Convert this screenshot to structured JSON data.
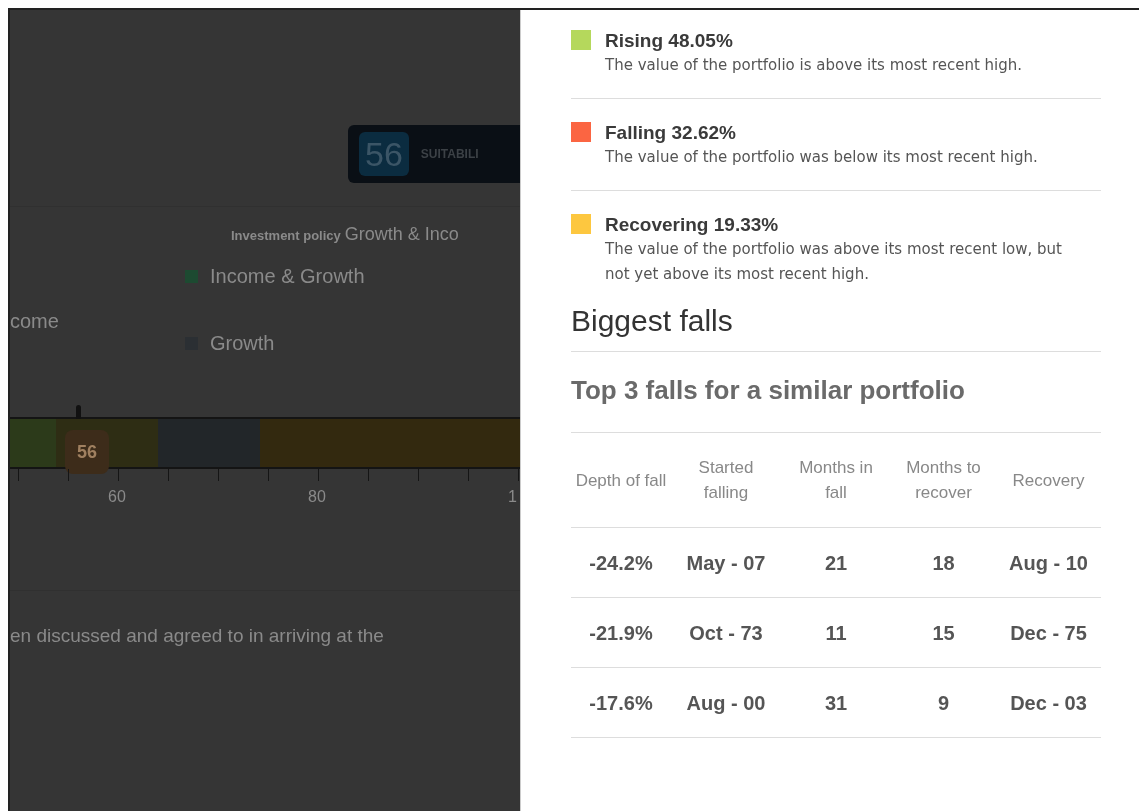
{
  "background_page": {
    "suitability_badge": {
      "score": "56",
      "label": "SUITABILI"
    },
    "investment_policy": {
      "label": "Investment policy",
      "value": "Growth & Inco"
    },
    "legend": [
      {
        "label": "Income & Growth",
        "color": "#1d4a31"
      },
      {
        "label": "come"
      },
      {
        "label": "Growth",
        "color": "#2b2f33"
      }
    ],
    "scale": {
      "segments": [
        {
          "color": "#2c3a1a"
        },
        {
          "color": "#2e2d14"
        },
        {
          "color": "#222629"
        },
        {
          "color": "#33290f"
        }
      ],
      "marker": "56",
      "tick_labels": [
        "60",
        "80",
        "1"
      ]
    },
    "note": "en discussed and agreed to in arriving at the"
  },
  "panel": {
    "states": [
      {
        "title": "Rising 48.05%",
        "description": "The value of the portfolio is above its most recent high.",
        "color": "#b5d85c"
      },
      {
        "title": "Falling 32.62%",
        "description": "The value of the portfolio was below its most recent high.",
        "color": "#fb6542"
      },
      {
        "title": "Recovering 19.33%",
        "description": "The value of the portfolio was above its most recent low, but not yet above its most recent high.",
        "color": "#fdc73f"
      }
    ],
    "section_title": "Biggest falls",
    "table_title": "Top 3 falls for a similar portfolio",
    "table": {
      "columns": [
        "Depth of fall",
        "Started falling",
        "Months in fall",
        "Months to recover",
        "Recovery"
      ],
      "rows": [
        [
          "-24.2%",
          "May - 07",
          "21",
          "18",
          "Aug - 10"
        ],
        [
          "-21.9%",
          "Oct - 73",
          "11",
          "15",
          "Dec - 75"
        ],
        [
          "-17.6%",
          "Aug - 00",
          "31",
          "9",
          "Dec - 03"
        ]
      ]
    }
  }
}
